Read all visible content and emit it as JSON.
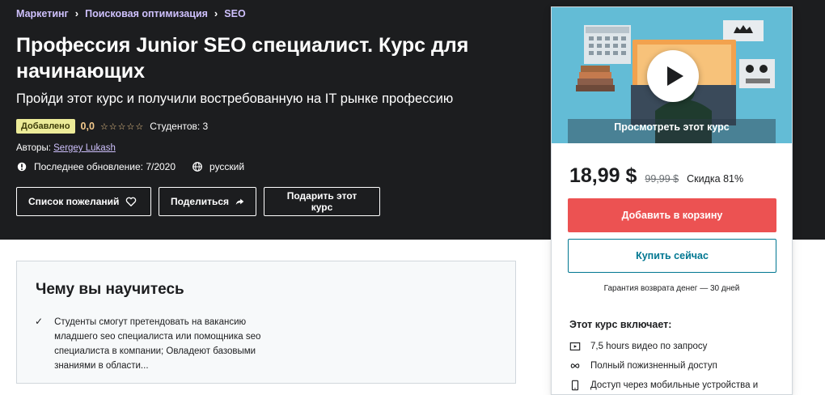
{
  "breadcrumb": [
    "Маркетинг",
    "Поисковая оптимизация",
    "SEO"
  ],
  "course": {
    "title": "Профессия Junior SEO специалист. Курс для начинающих",
    "subtitle": "Пройди этот курс и получили востребованную на IT рынке профессию",
    "badge": "Добавлено",
    "rating": "0,0",
    "stars": "☆☆☆☆☆",
    "students": "Студентов: 3",
    "authors_label": "Авторы:",
    "author": "Sergey Lukash",
    "last_update": "Последнее обновление: 7/2020",
    "language": "русский"
  },
  "actions": {
    "wishlist": "Список пожеланий",
    "share": "Поделиться",
    "gift": "Подарить этот курс"
  },
  "learn": {
    "title": "Чему вы научитесь",
    "item": "Студенты смогут претендовать на вакансию младшего seo специалиста или помощника seo специалиста в компании; Овладеют базовыми знаниями в области..."
  },
  "sidebar": {
    "preview_label": "Просмотреть этот курс",
    "price": "18,99 $",
    "old_price": "99,99 $",
    "discount": "Скидка 81%",
    "add_to_cart": "Добавить в корзину",
    "buy_now": "Купить сейчас",
    "guarantee": "Гарантия возврата денег — 30 дней",
    "includes_title": "Этот курс включает:",
    "includes": [
      "7,5 hours видео по запросу",
      "Полный пожизненный доступ",
      "Доступ через мобильные устройства и"
    ]
  },
  "colors": {
    "hero_bg": "#1c1d1f",
    "accent_link": "#cec0fc",
    "cart_button": "#ec5252",
    "buy_button": "#007791",
    "rating": "#f3ca8c"
  }
}
